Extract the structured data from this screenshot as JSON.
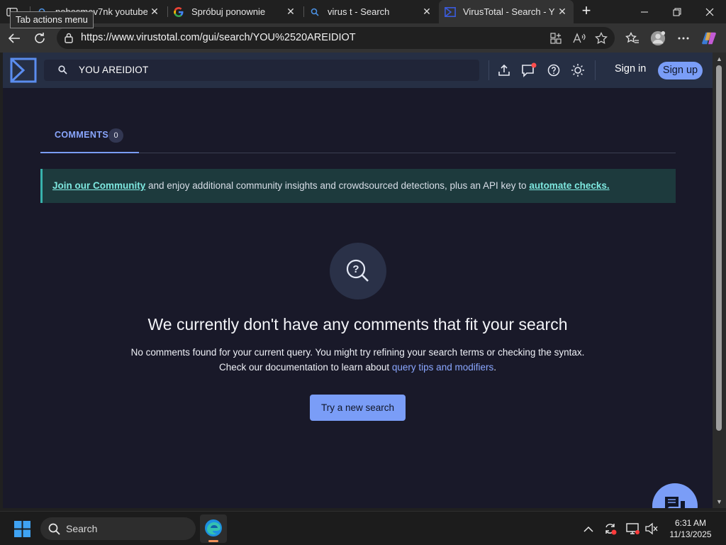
{
  "browser": {
    "tooltip": "Tab actions menu",
    "tabs": [
      {
        "title": "nobesmev7nk youtube",
        "icon": "search-icon"
      },
      {
        "title": "Spróbuj ponownie",
        "icon": "google-icon"
      },
      {
        "title": "virus t - Search",
        "icon": "search-icon"
      },
      {
        "title": "VirusTotal - Search - YOU AREIDIOT",
        "icon": "virustotal-icon",
        "active": true
      }
    ],
    "url": "https://www.virustotal.com/gui/search/YOU%2520AREIDIOT"
  },
  "vt": {
    "search_value": "YOU AREIDIOT",
    "signin": "Sign in",
    "signup": "Sign up",
    "tab_label": "COMMENTS",
    "tab_count": "0",
    "banner": {
      "link1": "Join our Community",
      "middle": " and enjoy additional community insights and crowdsourced detections, plus an API key to ",
      "link2": "automate checks."
    },
    "empty": {
      "title": "We currently don't have any comments that fit your search",
      "line1": "No comments found for your current query. You might try refining your search terms or checking the syntax.",
      "line2_prefix": "Check our documentation to learn about ",
      "line2_link": "query tips and modifiers",
      "line2_suffix": "."
    },
    "try_button": "Try a new search",
    "accent": "#7a9df7",
    "notification_color": "#ff4d4d"
  },
  "taskbar": {
    "search_placeholder": "Search",
    "time": "6:31 AM",
    "date": "11/13/2025"
  }
}
